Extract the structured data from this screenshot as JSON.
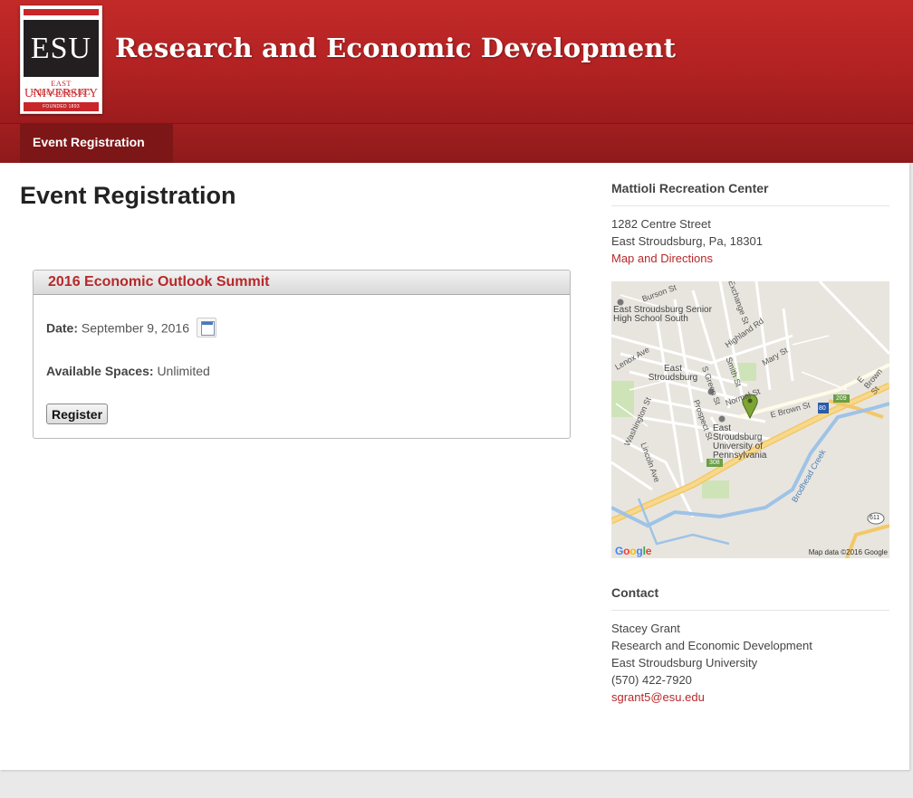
{
  "header": {
    "logo": {
      "letters": "ESU",
      "line1": "EAST STROUDSBURG",
      "line2": "UNIVERSITY",
      "founded": "FOUNDED 1893"
    },
    "site_title": "Research and Economic Development"
  },
  "nav": {
    "items": [
      {
        "label": "Event Registration"
      }
    ]
  },
  "main": {
    "page_title": "Event Registration",
    "event": {
      "title": "2016 Economic Outlook Summit",
      "date_label": "Date:",
      "date_value": "September 9, 2016",
      "spaces_label": "Available Spaces:",
      "spaces_value": "Unlimited",
      "register_label": "Register"
    }
  },
  "sidebar": {
    "location": {
      "heading": "Mattioli Recreation Center",
      "address1": "1282 Centre Street",
      "address2": "East Stroudsburg, Pa, 18301",
      "map_link": "Map and Directions"
    },
    "map": {
      "labels": {
        "school": "East Stroudsburg Senior High School South",
        "town": "East Stroudsburg",
        "university": "East Stroudsburg University of Pennsylvania",
        "burson": "Burson St",
        "exchange": "Exchange St",
        "highland": "Highland Rd",
        "mary": "Mary St",
        "lenox": "Lenox Ave",
        "smith": "Smith St",
        "green": "S Green St",
        "normal": "Normal St",
        "ebrown": "E Brown St",
        "washington": "Washington St",
        "prospect": "Prospect St",
        "lincoln": "Lincoln Ave",
        "brodhead": "Brodhead Creek",
        "shield209": "209",
        "shield80": "80",
        "shield308": "308",
        "shield611": "611"
      },
      "google": "Google",
      "credit": "Map data ©2016 Google"
    },
    "contact": {
      "heading": "Contact",
      "name": "Stacey Grant",
      "dept": "Research and Economic Development",
      "org": "East Stroudsburg University",
      "phone": "(570) 422-7920",
      "email": "sgrant5@esu.edu"
    }
  },
  "colors": {
    "brand_red": "#b7282a",
    "header_red": "#b32223",
    "nav_active": "#7d1617"
  }
}
